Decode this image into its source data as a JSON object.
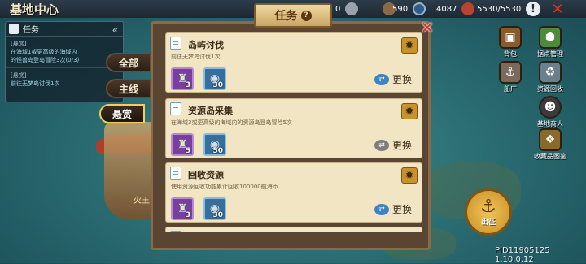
{
  "header": {
    "title": "基地中心",
    "resources": [
      {
        "icon": "gem-icon",
        "value": "0",
        "color": "#c9cfd6"
      },
      {
        "icon": "planet-icon",
        "value": "590",
        "color": "#8b6a48"
      },
      {
        "icon": "coin-icon",
        "value": "4087",
        "color": "#2b5d8a"
      },
      {
        "icon": "meat-icon",
        "value": "5530/5530",
        "color": "#b5452e"
      }
    ]
  },
  "sidebar": {
    "title": "任务",
    "items": [
      {
        "tag": "[悬赏]",
        "lines": [
          "在海域1或更高级的海域内",
          "的怪兽岛登岛冒险3次(0/3)"
        ]
      },
      {
        "tag": "[悬赏]",
        "lines": [
          "前往无梦岛讨伐1次"
        ]
      }
    ]
  },
  "filters": {
    "all": "全部",
    "main": "主线",
    "bounty": "悬赏"
  },
  "modal": {
    "title": "任务",
    "tasks": [
      {
        "name": "岛屿讨伐",
        "desc": "前往无梦岛讨伐1次",
        "rewards": [
          {
            "icon": "soldier-icon",
            "count": "3"
          },
          {
            "icon": "coin-icon",
            "count": "30"
          }
        ],
        "swap_label": "更换"
      },
      {
        "name": "资源岛采集",
        "desc": "在海域3或更高级的海域内的资源岛登岛冒险5次",
        "rewards": [
          {
            "icon": "soldier-icon",
            "count": "5"
          },
          {
            "icon": "coin-icon",
            "count": "50"
          }
        ],
        "swap_label": "更换"
      },
      {
        "name": "回收资源",
        "desc": "使用资源回收功能累计回收100000航海币",
        "rewards": [
          {
            "icon": "soldier-icon",
            "count": "3"
          },
          {
            "icon": "coin-icon",
            "count": "30"
          }
        ],
        "swap_label": "更换"
      }
    ]
  },
  "right_menu": [
    {
      "label": "背包",
      "icon": "backpack-icon",
      "color": "#8b5a2b"
    },
    {
      "label": "据点管理",
      "icon": "map-pin-icon",
      "color": "#4d8a3b"
    },
    {
      "label": "船厂",
      "icon": "shipyard-icon",
      "color": "#7b6a5a"
    },
    {
      "label": "资源回收",
      "icon": "recycle-icon",
      "color": "#6b7f8c"
    },
    {
      "label": "基地商人",
      "icon": "merchant-icon",
      "color": "#3b3b3b"
    },
    {
      "label": "收藏品图鉴",
      "icon": "collection-icon",
      "color": "#8a6a2a"
    }
  ],
  "sail_button": "出征",
  "island_label": "火王",
  "build_id": "PID11905125 1.10.0.12"
}
